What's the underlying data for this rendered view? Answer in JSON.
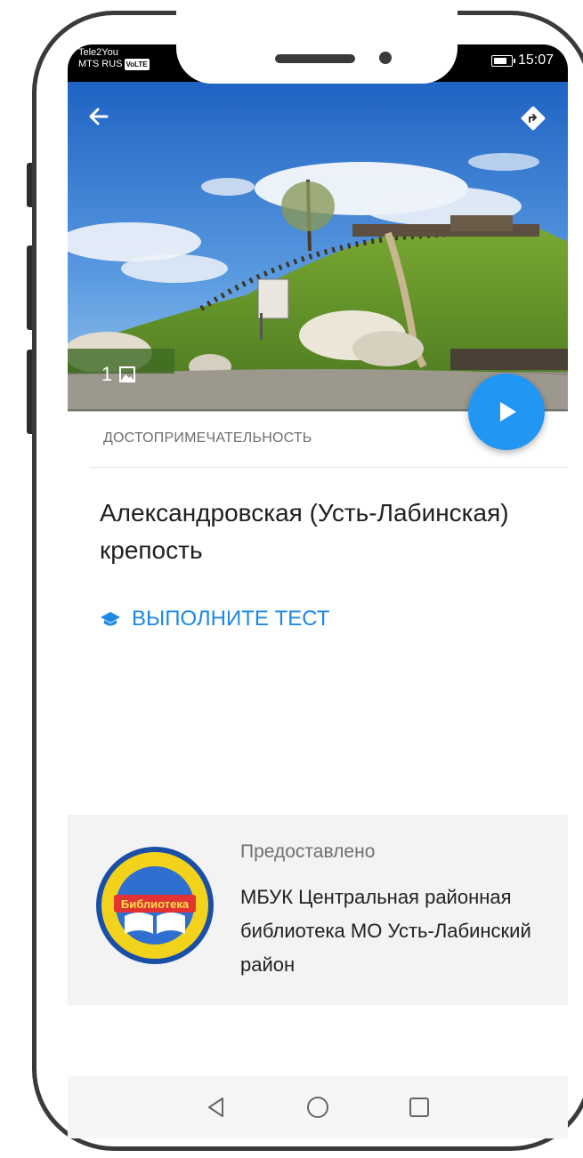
{
  "status_bar": {
    "carrier_1": "Tele2You",
    "carrier_2": "MTS RUS",
    "volte": "VoLTE",
    "time": "15:07"
  },
  "hero": {
    "photo_count": "1"
  },
  "poi": {
    "category": "ДОСТОПРИМЕЧАТЕЛЬНОСТЬ",
    "title": "Александровская (Усть-Лабинская) крепость",
    "quiz_label": "ВЫПОЛНИТЕ ТЕСТ"
  },
  "provided": {
    "label": "Предоставлено",
    "organization": "МБУК Центральная районная библиотека МО Усть-Лабинский район",
    "logo_text": "Библиотека"
  },
  "colors": {
    "accent": "#2196f3",
    "link": "#1e88e5",
    "panel": "#f3f3f3"
  },
  "icons": {
    "back": "arrow-left-icon",
    "directions": "directions-icon",
    "gallery": "image-icon",
    "play": "play-icon",
    "quiz": "graduation-cap-icon",
    "nav_back": "triangle-back-icon",
    "nav_home": "circle-home-icon",
    "nav_recent": "square-recent-icon"
  }
}
